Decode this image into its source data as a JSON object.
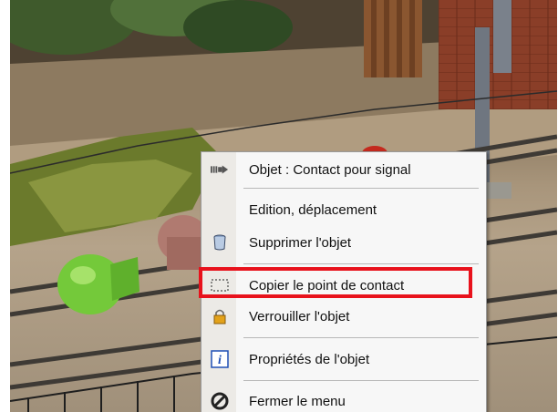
{
  "context_menu": {
    "items": [
      {
        "label": "Objet : Contact pour signal",
        "icon": "signal-contact-icon"
      },
      {
        "label": "Edition, déplacement",
        "icon": ""
      },
      {
        "label": "Supprimer l'objet",
        "icon": "trash-can-icon"
      },
      {
        "label": "Copier le point de contact",
        "icon": "copy-selection-icon"
      },
      {
        "label": "Verrouiller l'objet",
        "icon": "padlock-icon"
      },
      {
        "label": "Propriétés de l'objet",
        "icon": "info-icon"
      },
      {
        "label": "Fermer le menu",
        "icon": "close-circle-icon"
      }
    ],
    "highlighted_index": 3
  },
  "colors": {
    "highlight_border": "#e8121c",
    "menu_background": "#f7f7f7",
    "info_icon_blue": "#1f4fb5"
  }
}
